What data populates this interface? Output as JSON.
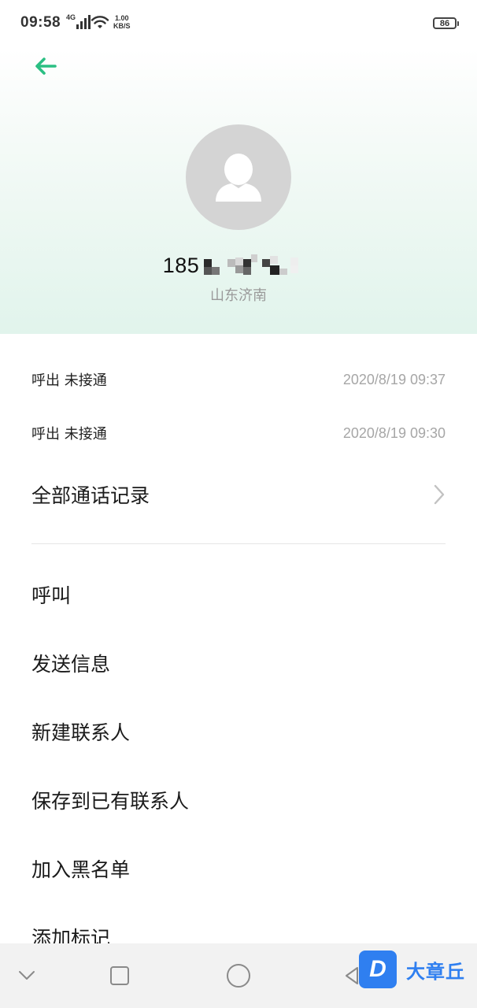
{
  "status_bar": {
    "time": "09:58",
    "network_type": "4G",
    "speed_value": "1.00",
    "speed_unit": "KB/S",
    "battery": "86"
  },
  "contact": {
    "number_prefix": "185",
    "location": "山东济南"
  },
  "call_log": [
    {
      "type": "呼出 未接通",
      "time": "2020/8/19 09:37"
    },
    {
      "type": "呼出 未接通",
      "time": "2020/8/19 09:30"
    }
  ],
  "all_calls_label": "全部通话记录",
  "actions": [
    "呼叫",
    "发送信息",
    "新建联系人",
    "保存到已有联系人",
    "加入黑名单",
    "添加标记"
  ],
  "watermark": {
    "logo_letter": "D",
    "text": "大章丘"
  },
  "colors": {
    "accent": "#2bbf83",
    "watermark": "#2f7ff0"
  },
  "icons": {
    "back": "arrow-left-icon",
    "avatar": "person-silhouette-icon",
    "chevron": "chevron-right-icon",
    "nav_collapse": "chevron-down-icon",
    "nav_recents": "square-icon",
    "nav_home": "circle-icon",
    "nav_back": "triangle-left-icon"
  }
}
